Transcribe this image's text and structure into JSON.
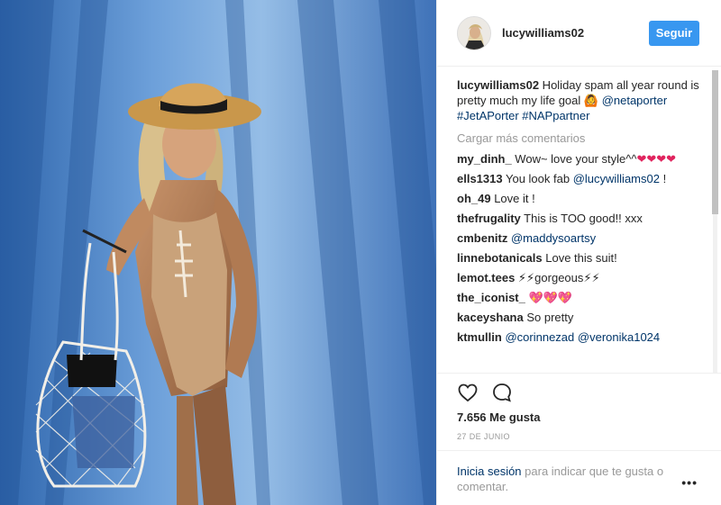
{
  "post": {
    "username": "lucywilliams02",
    "follow_label": "Seguir"
  },
  "caption": {
    "username": "lucywilliams02",
    "text_1": " Holiday spam all year round is pretty much my life goal 🙆 ",
    "mention": "@netaporter",
    "tags": "#JetAPorter #NAPpartner"
  },
  "load_more_label": "Cargar más comentarios",
  "comments": [
    {
      "user": "my_dinh_",
      "text": " Wow~ love your style^^",
      "extra": "❤❤❤❤"
    },
    {
      "user": "ells1313",
      "text": " You look fab ",
      "mention": "@lucywilliams02",
      "after": " !"
    },
    {
      "user": "oh_49",
      "text": " Love it !"
    },
    {
      "user": "thefrugality",
      "text": " This is TOO good!! xxx"
    },
    {
      "user": "cmbenitz",
      "text": " ",
      "mention": "@maddysoartsy"
    },
    {
      "user": "linnebotanicals",
      "text": " Love this suit!"
    },
    {
      "user": "lemot.tees",
      "text": " ⚡⚡gorgeous⚡⚡"
    },
    {
      "user": "the_iconist_",
      "text": " ",
      "extra": "💖💖💖"
    },
    {
      "user": "kaceyshana",
      "text": " So pretty"
    },
    {
      "user": "ktmullin",
      "text": " ",
      "mention": "@corinnezad",
      "mention2": "@veronika1024"
    }
  ],
  "likes": "7.656 Me gusta",
  "date": "27 DE JUNIO",
  "footer": {
    "login": "Inicia sesión",
    "text": " para indicar que te gusta o comentar."
  },
  "more_label": "•••",
  "colors": {
    "accent": "#3897f0",
    "link": "#003569",
    "muted": "#999999"
  },
  "icons": [
    "heart-icon",
    "comment-icon",
    "more-options-icon"
  ]
}
